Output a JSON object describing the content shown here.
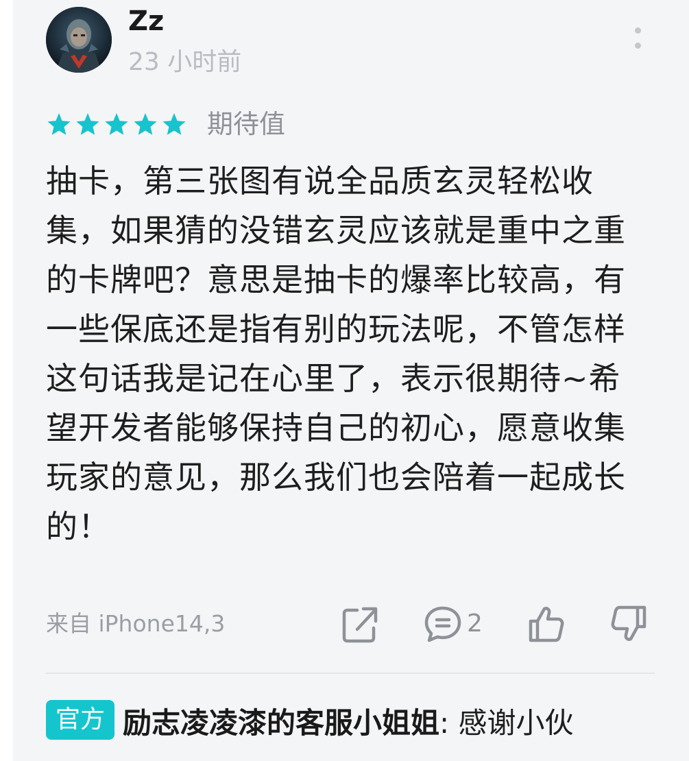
{
  "review": {
    "username": "Zz",
    "timestamp": "23 小时前",
    "rating_stars": 5,
    "rating_label": "期待值",
    "body": "抽卡，第三张图有说全品质玄灵轻松收集，如果猜的没错玄灵应该就是重中之重的卡牌吧？意思是抽卡的爆率比较高，有一些保底还是指有别的玩法呢，不管怎样这句话我是记在心里了，表示很期待~希望开发者能够保持自己的初心，愿意收集玩家的意见，那么我们也会陪着一起成长的！",
    "device": "来自 iPhone14,3",
    "comment_count": "2"
  },
  "reply": {
    "badge": "官方",
    "author": "励志凌凌漆的客服小姐姐",
    "separator": ":",
    "text": " 感谢小伙"
  },
  "icons": {
    "avatar": "user-avatar",
    "more": "more-vertical-icon",
    "share": "share-icon",
    "comment": "comment-icon",
    "like": "thumbs-up-icon",
    "dislike": "thumbs-down-icon",
    "star": "star-icon"
  },
  "colors": {
    "accent": "#15c5ce",
    "star": "#17c3cc",
    "muted": "#9a9ea4",
    "card_bg": "#f4f5f7"
  }
}
